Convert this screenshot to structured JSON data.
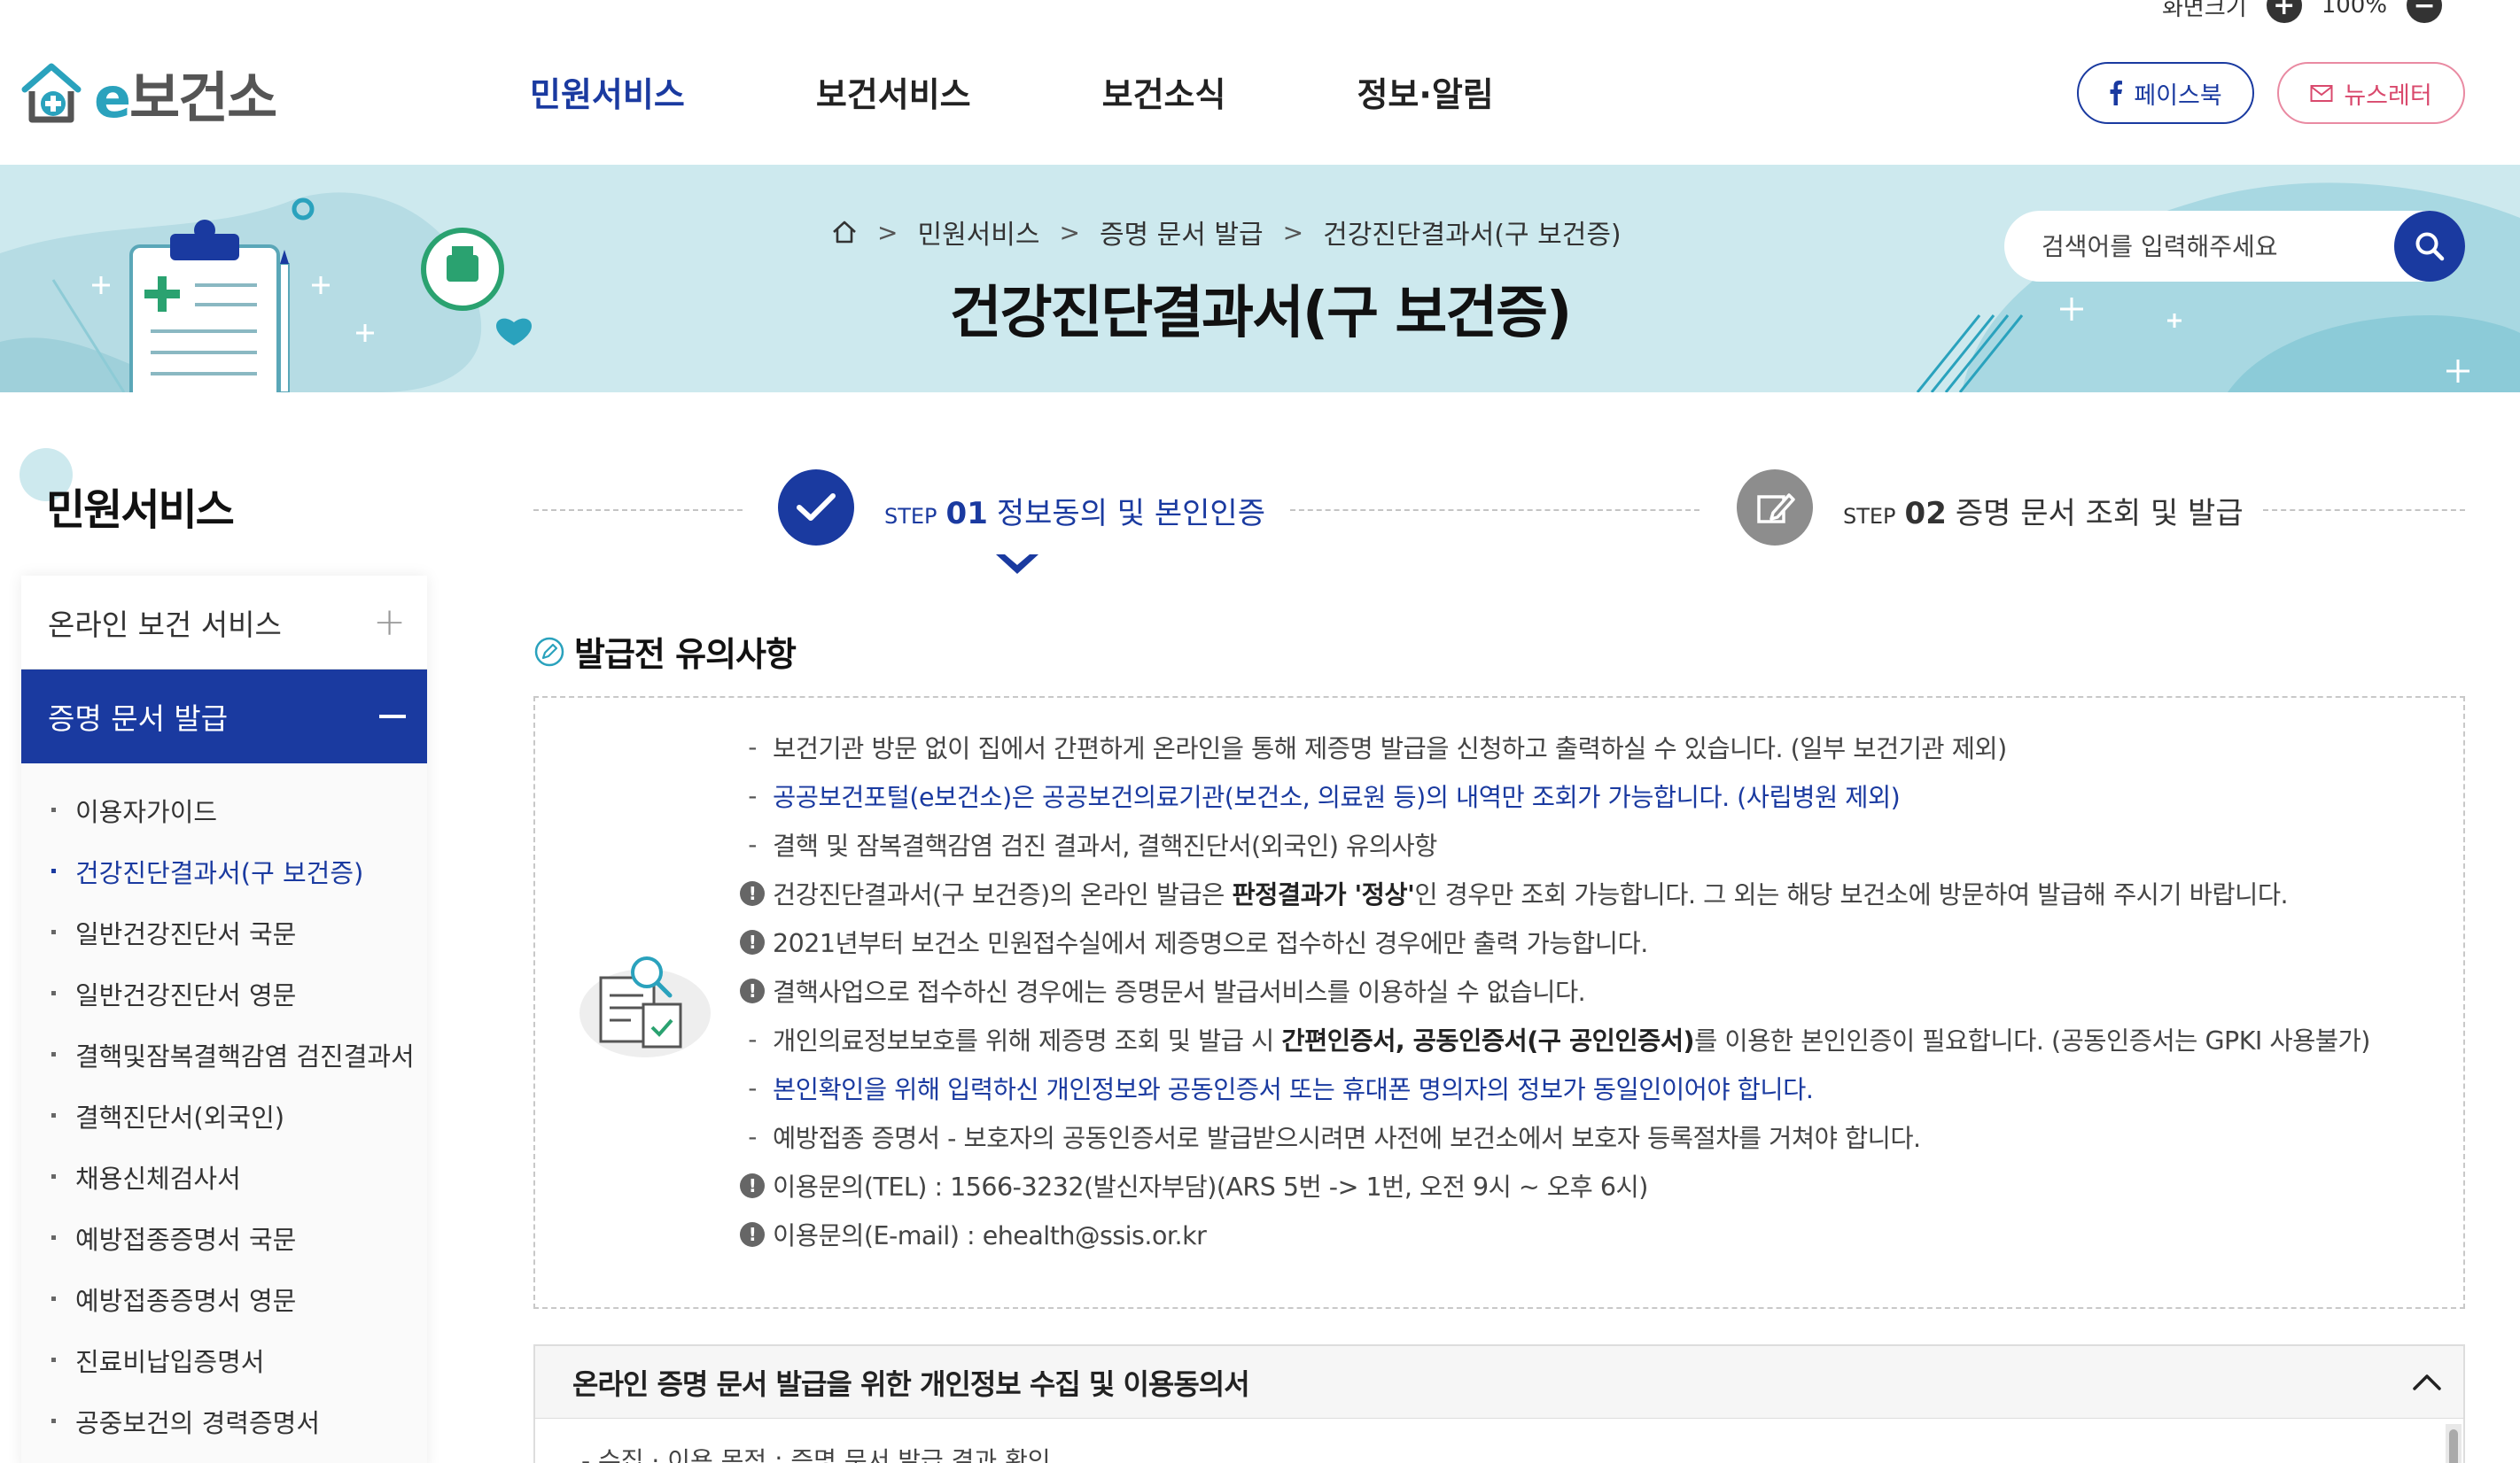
{
  "zoom": {
    "label": "화면크기",
    "value": "100%"
  },
  "logo": {
    "e": "e",
    "text": "보건소"
  },
  "gnb": [
    "민원서비스",
    "보건서비스",
    "보건소식",
    "정보·알림"
  ],
  "sns": {
    "facebook": "페이스북",
    "newsletter": "뉴스레터"
  },
  "breadcrumb": [
    "민원서비스",
    "증명 문서 발급",
    "건강진단결과서(구 보건증)"
  ],
  "page_title": "건강진단결과서(구 보건증)",
  "search": {
    "placeholder": "검색어를 입력해주세요"
  },
  "sidebar": {
    "title": "민원서비스",
    "categories": [
      {
        "label": "온라인 보건 서비스"
      },
      {
        "label": "증명 문서 발급"
      }
    ],
    "items": [
      "이용자가이드",
      "건강진단결과서(구 보건증)",
      "일반건강진단서 국문",
      "일반건강진단서 영문",
      "결핵및잠복결핵감염 검진결과서",
      "결핵진단서(외국인)",
      "채용신체검사서",
      "예방접종증명서 국문",
      "예방접종증명서 영문",
      "진료비납입증명서",
      "공중보건의 경력증명서"
    ]
  },
  "steps": [
    {
      "step": "STEP",
      "num": "01",
      "label": "정보동의 및 본인인증"
    },
    {
      "step": "STEP",
      "num": "02",
      "label": "증명 문서 조회 및 발급"
    }
  ],
  "notice": {
    "title": "발급전 유의사항",
    "items": [
      {
        "type": "dash",
        "text": "보건기관 방문 없이 집에서 간편하게 온라인을 통해 제증명 발급을 신청하고 출력하실 수 있습니다. (일부 보건기관 제외)"
      },
      {
        "type": "dash",
        "blue": true,
        "text": "공공보건포털(e보건소)은 공공보건의료기관(보건소, 의료원 등)의 내역만 조회가 가능합니다. (사립병원 제외)"
      },
      {
        "type": "dash",
        "text": "결핵 및 잠복결핵감염 검진 결과서, 결핵진단서(외국인) 유의사항"
      },
      {
        "type": "warn",
        "pre": "건강진단결과서(구 보건증)의 온라인 발급은 ",
        "bold": "판정결과가 '정상'",
        "post": "인 경우만 조회 가능합니다. 그 외는 해당 보건소에 방문하여 발급해 주시기 바랍니다."
      },
      {
        "type": "warn",
        "text": "2021년부터 보건소 민원접수실에서 제증명으로 접수하신 경우에만 출력 가능합니다."
      },
      {
        "type": "warn",
        "text": "결핵사업으로 접수하신 경우에는 증명문서 발급서비스를 이용하실 수 없습니다."
      },
      {
        "type": "dash",
        "pre": "개인의료정보보호를 위해 제증명 조회 및 발급 시 ",
        "bold": "간편인증서, 공동인증서(구 공인인증서)",
        "post": "를 이용한 본인인증이 필요합니다. (공동인증서는 GPKI 사용불가)"
      },
      {
        "type": "dash",
        "blue": true,
        "text": "본인확인을 위해 입력하신 개인정보와 공동인증서 또는 휴대폰 명의자의 정보가 동일인이어야 합니다."
      },
      {
        "type": "dash",
        "text": "예방접종 증명서 - 보호자의 공동인증서로 발급받으시려면 사전에 보건소에서 보호자 등록절차를 거쳐야 합니다."
      },
      {
        "type": "warn",
        "text": "이용문의(TEL) : 1566-3232(발신자부담)(ARS 5번 -> 1번, 오전 9시 ~ 오후 6시)"
      },
      {
        "type": "warn",
        "text": "이용문의(E-mail) : ehealth@ssis.or.kr"
      }
    ]
  },
  "agreement": {
    "title": "온라인 증명 문서 발급을 위한 개인정보 수집 및 이용동의서",
    "first_line": "- 수집 · 이용 목적 : 증명 문서 발급 결과 확인"
  },
  "colors": {
    "primary": "#1a3aa0",
    "banner": "#cde9ee",
    "teal": "#2aa2bd"
  }
}
